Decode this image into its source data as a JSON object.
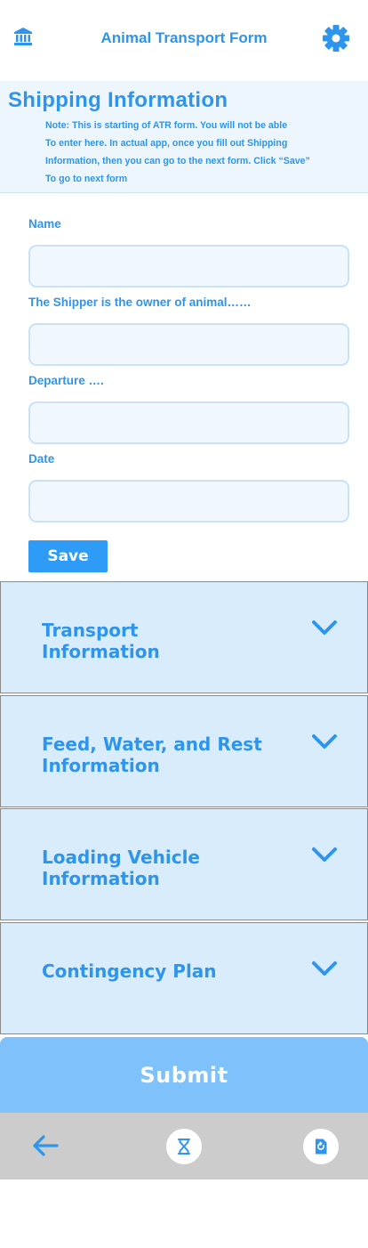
{
  "header": {
    "title": "Animal Transport Form",
    "left_icon": "bank-icon",
    "right_icon": "gear-icon"
  },
  "shipping": {
    "title": "Shipping Information",
    "note_lines": [
      "Note: This is starting of ATR form. You will not be able",
      "To enter here. In actual app, once you fill out Shipping",
      "Information, then you can go to the next form. Click “Save”",
      "To go to next form"
    ],
    "fields": [
      {
        "label": "Name",
        "value": "",
        "placeholder": ""
      },
      {
        "label": "The Shipper is the owner of animal……",
        "value": "",
        "placeholder": ""
      },
      {
        "label": "Departure ….",
        "value": "",
        "placeholder": ""
      },
      {
        "label": "Date",
        "value": "",
        "placeholder": ""
      }
    ],
    "save_label": "Save"
  },
  "sections": [
    {
      "label_lines": [
        "Transport",
        "Information"
      ]
    },
    {
      "label_lines": [
        "Feed, Water, and Rest",
        "Information"
      ]
    },
    {
      "label_lines": [
        "Loading Vehicle",
        "Information"
      ]
    },
    {
      "label_lines": [
        "Contingency Plan"
      ]
    }
  ],
  "submit_label": "Submit",
  "bottom_bar": {
    "icons": [
      "back-arrow-icon",
      "hourglass-icon",
      "restore-icon"
    ]
  },
  "colors": {
    "accent": "#2e95ec",
    "button": "#2e9cf6",
    "submit": "#7ec1fb",
    "section_bg": "#d9ecfc",
    "bottom_bar": "#cccccc"
  }
}
